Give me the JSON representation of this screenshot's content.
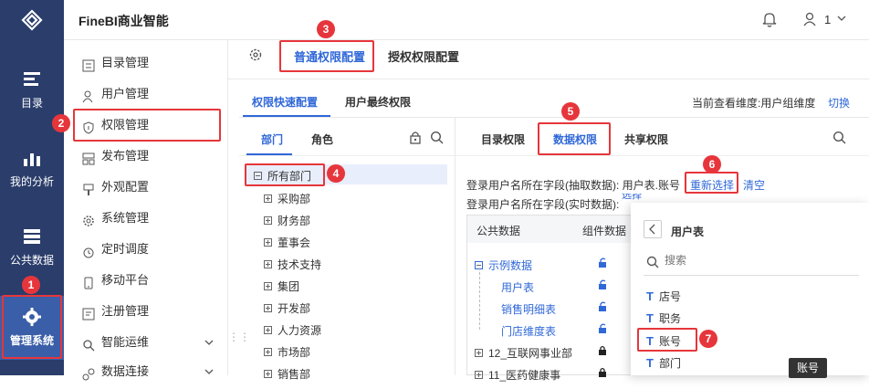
{
  "app": {
    "title": "FineBI商业智能",
    "user_label": "1",
    "brand_color": "#2a3d6b",
    "accent": "#3068d8",
    "highlight": "#e6363b"
  },
  "nav": [
    {
      "label": "目录",
      "icon": "catalog-icon"
    },
    {
      "label": "我的分析",
      "icon": "analysis-icon"
    },
    {
      "label": "公共数据",
      "icon": "database-icon"
    },
    {
      "label": "管理系统",
      "icon": "gear-icon",
      "active": true
    }
  ],
  "sidebar": [
    {
      "label": "目录管理"
    },
    {
      "label": "用户管理"
    },
    {
      "label": "权限管理",
      "active": true
    },
    {
      "label": "发布管理"
    },
    {
      "label": "外观配置"
    },
    {
      "label": "系统管理"
    },
    {
      "label": "定时调度"
    },
    {
      "label": "移动平台"
    },
    {
      "label": "注册管理"
    },
    {
      "label": "智能运维"
    },
    {
      "label": "数据连接"
    }
  ],
  "tabs_top": [
    "普通权限配置",
    "授权权限配置"
  ],
  "tabs_sub": [
    "权限快速配置",
    "用户最终权限"
  ],
  "dimension": {
    "label": "当前查看维度:用户组维度",
    "switch": "切换"
  },
  "left_tabs": [
    "部门",
    "角色"
  ],
  "tree": {
    "root": "所有部门",
    "children": [
      "采购部",
      "财务部",
      "董事会",
      "技术支持",
      "集团",
      "开发部",
      "人力资源",
      "市场部",
      "销售部"
    ]
  },
  "right_tabs": [
    "目录权限",
    "数据权限",
    "共享权限"
  ],
  "field_line1": {
    "prefix": "登录用户名所在字段(抽取数据):",
    "value": "用户表.账号",
    "reselect": "重新选择",
    "clear": "清空"
  },
  "field_line2": {
    "prefix": "登录用户名所在字段(实时数据):",
    "partial": "选择"
  },
  "table": {
    "headers": [
      "公共数据",
      "组件数据"
    ],
    "rows": [
      "示例数据",
      "用户表",
      "销售明细表",
      "门店维度表",
      "12_互联网事业部",
      "11_医药健康事"
    ]
  },
  "popup": {
    "title": "用户表",
    "search_placeholder": "搜索",
    "fields": [
      "店号",
      "职务",
      "账号",
      "部门"
    ],
    "tooltip": "账号"
  },
  "badges": [
    "1",
    "2",
    "3",
    "4",
    "5",
    "6",
    "7"
  ]
}
